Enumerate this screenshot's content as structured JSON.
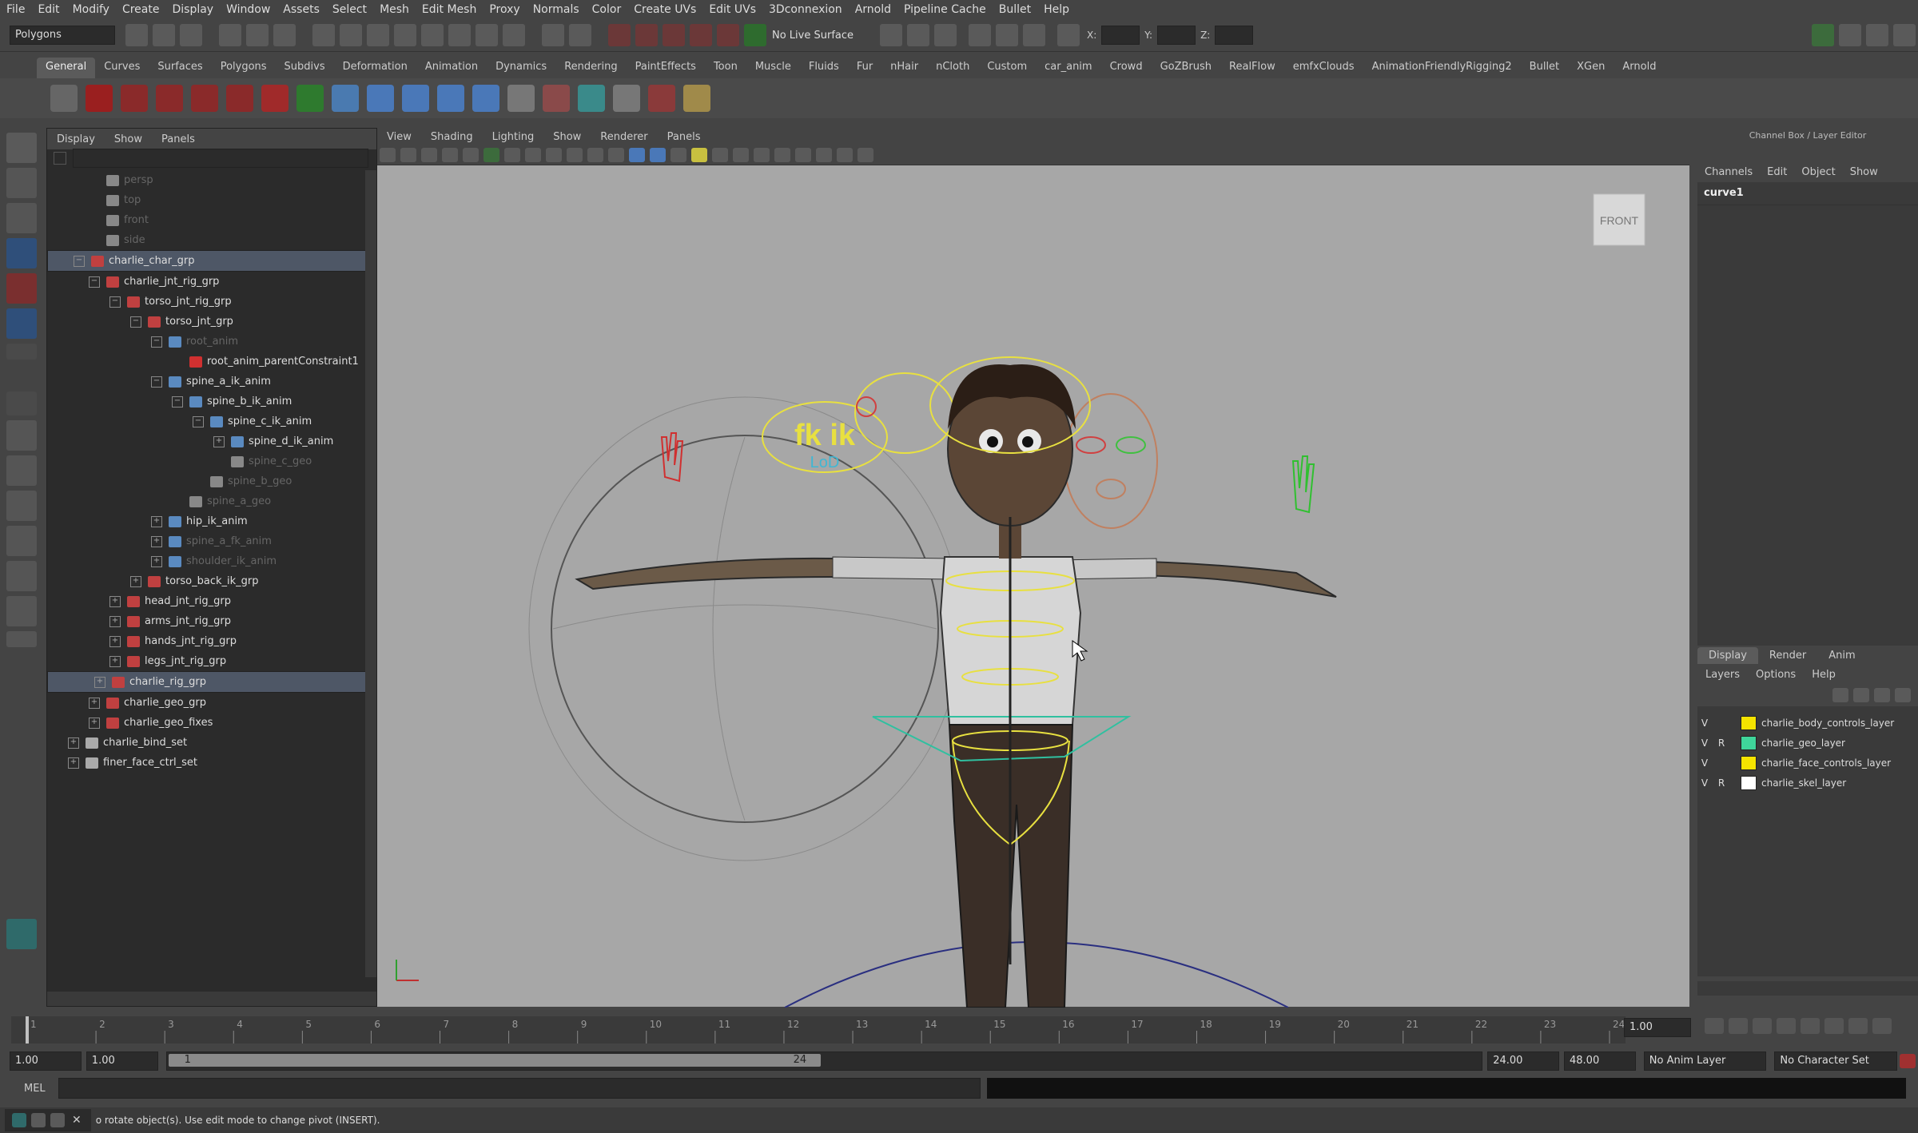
{
  "menubar": [
    "File",
    "Edit",
    "Modify",
    "Create",
    "Display",
    "Window",
    "Assets",
    "Select",
    "Mesh",
    "Edit Mesh",
    "Proxy",
    "Normals",
    "Color",
    "Create UVs",
    "Edit UVs",
    "3Dconnexion",
    "Arnold",
    "Pipeline Cache",
    "Bullet",
    "Help"
  ],
  "statusline": {
    "mode_menu": "Polygons",
    "live_surface": "No Live Surface",
    "x_label": "X:",
    "y_label": "Y:",
    "z_label": "Z:"
  },
  "shelf_tabs": [
    "General",
    "Curves",
    "Surfaces",
    "Polygons",
    "Subdivs",
    "Deformation",
    "Animation",
    "Dynamics",
    "Rendering",
    "PaintEffects",
    "Toon",
    "Muscle",
    "Fluids",
    "Fur",
    "nHair",
    "nCloth",
    "Custom",
    "car_anim",
    "Crowd",
    "GoZBrush",
    "RealFlow",
    "emfxClouds",
    "AnimationFriendlyRigging2",
    "Bullet",
    "XGen",
    "Arnold"
  ],
  "outliner": {
    "menu": [
      "Display",
      "Show",
      "Panels"
    ],
    "items": [
      {
        "label": "persp",
        "depth": 2,
        "icon": "camera-icon",
        "dim": true,
        "exp": ""
      },
      {
        "label": "top",
        "depth": 2,
        "icon": "camera-icon",
        "dim": true,
        "exp": ""
      },
      {
        "label": "front",
        "depth": 2,
        "icon": "camera-icon",
        "dim": true,
        "exp": ""
      },
      {
        "label": "side",
        "depth": 2,
        "icon": "camera-icon",
        "dim": true,
        "exp": ""
      },
      {
        "label": "charlie_char_grp",
        "depth": 1,
        "icon": "group-icon",
        "sel": true,
        "exp": "−"
      },
      {
        "label": "charlie_jnt_rig_grp",
        "depth": 2,
        "icon": "group-icon",
        "exp": "−"
      },
      {
        "label": "torso_jnt_rig_grp",
        "depth": 3,
        "icon": "group-icon",
        "exp": "−"
      },
      {
        "label": "torso_jnt_grp",
        "depth": 4,
        "icon": "group-icon",
        "exp": "−"
      },
      {
        "label": "root_anim",
        "depth": 5,
        "icon": "joint-icon",
        "dim": true,
        "exp": "−"
      },
      {
        "label": "root_anim_parentConstraint1",
        "depth": 6,
        "icon": "constraint-icon",
        "exp": ""
      },
      {
        "label": "spine_a_ik_anim",
        "depth": 5,
        "icon": "joint-icon",
        "exp": "−"
      },
      {
        "label": "spine_b_ik_anim",
        "depth": 6,
        "icon": "joint-icon",
        "exp": "−"
      },
      {
        "label": "spine_c_ik_anim",
        "depth": 7,
        "icon": "joint-icon",
        "exp": "−"
      },
      {
        "label": "spine_d_ik_anim",
        "depth": 8,
        "icon": "joint-icon",
        "exp": "+"
      },
      {
        "label": "spine_c_geo",
        "depth": 8,
        "icon": "mesh-icon",
        "dim": true,
        "exp": ""
      },
      {
        "label": "spine_b_geo",
        "depth": 7,
        "icon": "mesh-icon",
        "dim": true,
        "exp": ""
      },
      {
        "label": "spine_a_geo",
        "depth": 6,
        "icon": "mesh-icon",
        "dim": true,
        "exp": ""
      },
      {
        "label": "hip_ik_anim",
        "depth": 5,
        "icon": "joint-icon",
        "exp": "+"
      },
      {
        "label": "spine_a_fk_anim",
        "depth": 5,
        "icon": "joint-icon",
        "dim": true,
        "exp": "+"
      },
      {
        "label": "shoulder_ik_anim",
        "depth": 5,
        "icon": "joint-icon",
        "dim": true,
        "exp": "+"
      },
      {
        "label": "torso_back_ik_grp",
        "depth": 4,
        "icon": "group-icon",
        "exp": "+"
      },
      {
        "label": "head_jnt_rig_grp",
        "depth": 3,
        "icon": "group-icon",
        "exp": "+"
      },
      {
        "label": "arms_jnt_rig_grp",
        "depth": 3,
        "icon": "group-icon",
        "exp": "+"
      },
      {
        "label": "hands_jnt_rig_grp",
        "depth": 3,
        "icon": "group-icon",
        "exp": "+"
      },
      {
        "label": "legs_jnt_rig_grp",
        "depth": 3,
        "icon": "group-icon",
        "exp": "+"
      },
      {
        "label": "charlie_rig_grp",
        "depth": 2,
        "icon": "group-icon",
        "sel": true,
        "exp": "+"
      },
      {
        "label": "charlie_geo_grp",
        "depth": 2,
        "icon": "group-icon",
        "exp": "+"
      },
      {
        "label": "charlie_geo_fixes",
        "depth": 2,
        "icon": "group-icon",
        "exp": "+"
      },
      {
        "label": "charlie_bind_set",
        "depth": 1,
        "icon": "set-icon",
        "exp": "+"
      },
      {
        "label": "finer_face_ctrl_set",
        "depth": 1,
        "icon": "set-icon",
        "exp": "+"
      }
    ]
  },
  "viewport": {
    "menu": [
      "View",
      "Shading",
      "Lighting",
      "Show",
      "Renderer",
      "Panels"
    ],
    "view_cube": "FRONT",
    "fkik_label": "fk  ik",
    "lod_label": "LoD"
  },
  "channelbox": {
    "title": "Channel Box / Layer Editor",
    "menu": [
      "Channels",
      "Edit",
      "Object",
      "Show"
    ],
    "object": "curve1"
  },
  "layers": {
    "tabs": [
      "Display",
      "Render",
      "Anim"
    ],
    "menu": [
      "Layers",
      "Options",
      "Help"
    ],
    "rows": [
      {
        "v": "V",
        "r": "",
        "name": "charlie_body_controls_layer",
        "color": "#f5e400"
      },
      {
        "v": "V",
        "r": "R",
        "name": "charlie_geo_layer",
        "color": "#3fd59a"
      },
      {
        "v": "V",
        "r": "",
        "name": "charlie_face_controls_layer",
        "color": "#f5e400"
      },
      {
        "v": "V",
        "r": "R",
        "name": "charlie_skel_layer",
        "color": "#ffffff"
      }
    ]
  },
  "timeslider": {
    "ticks": [
      "1",
      "2",
      "3",
      "4",
      "5",
      "6",
      "7",
      "8",
      "9",
      "10",
      "11",
      "12",
      "13",
      "14",
      "15",
      "16",
      "17",
      "18",
      "19",
      "20",
      "21",
      "22",
      "23",
      "24"
    ],
    "current": "1.00"
  },
  "range": {
    "start": "1.00",
    "start2": "1.00",
    "inner_start": "1",
    "inner_end": "24",
    "end": "24.00",
    "end2": "48.00",
    "anim_layer": "No Anim Layer",
    "char_set": "No Character Set"
  },
  "cmdline": {
    "label": "MEL"
  },
  "helpline": {
    "text": "o rotate object(s). Use edit mode to change pivot (INSERT)."
  },
  "colors": {
    "accent": "#5b7ea8",
    "viewport_bg": "#a7a7a7",
    "panel_bg": "#444444",
    "outliner_bg": "#2b2b2b",
    "selection": "#4e5766"
  }
}
